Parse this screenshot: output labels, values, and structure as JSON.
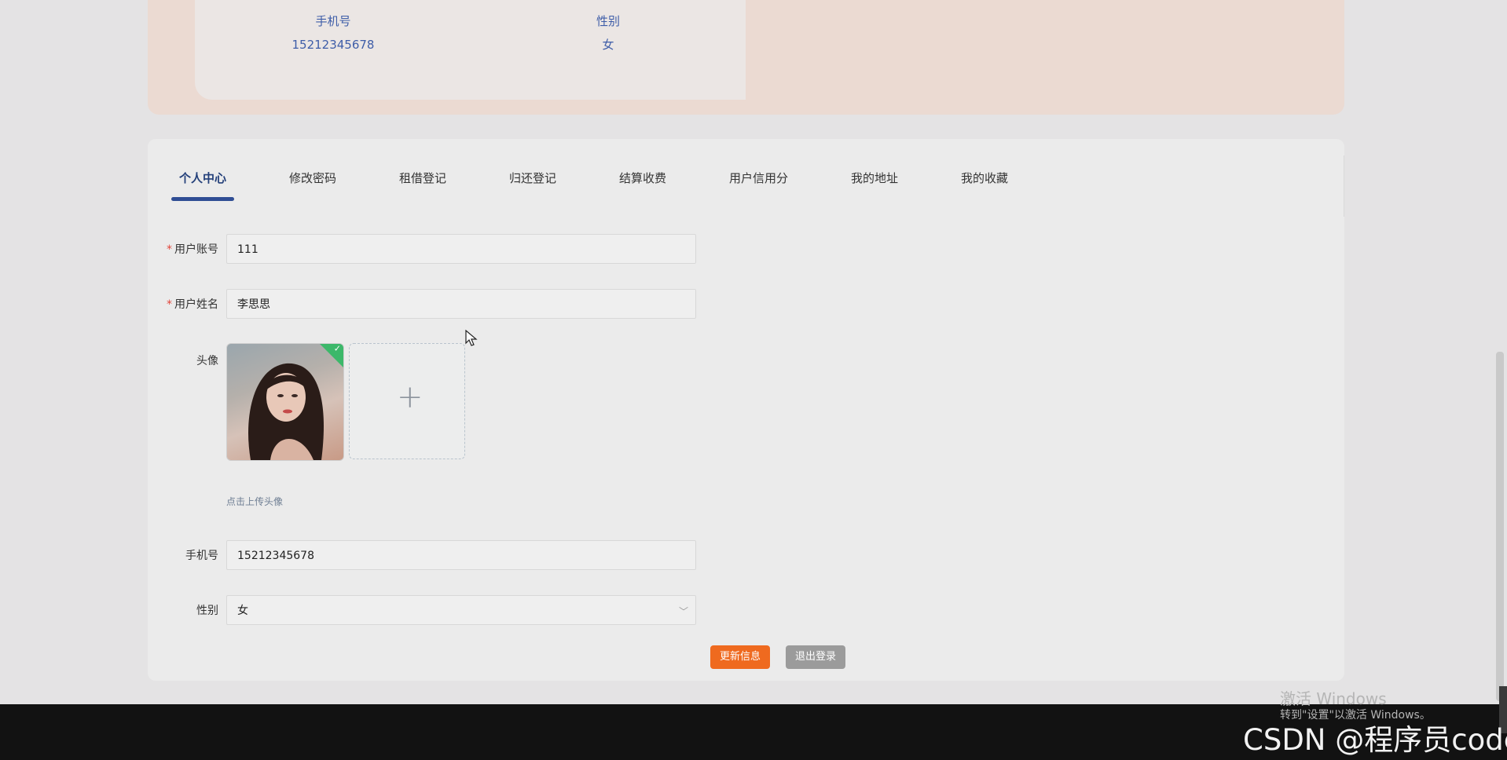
{
  "profile_summary": {
    "phone_label": "手机号",
    "phone_value": "15212345678",
    "gender_label": "性别",
    "gender_value": "女"
  },
  "tabs": [
    {
      "label": "个人中心",
      "active": true
    },
    {
      "label": "修改密码"
    },
    {
      "label": "租借登记"
    },
    {
      "label": "归还登记"
    },
    {
      "label": "结算收费"
    },
    {
      "label": "用户信用分"
    },
    {
      "label": "我的地址"
    },
    {
      "label": "我的收藏"
    }
  ],
  "form": {
    "account_label": "用户账号",
    "account_value": "111",
    "name_label": "用户姓名",
    "name_value": "李思思",
    "avatar_label": "头像",
    "avatar_hint": "点击上传头像",
    "phone_label": "手机号",
    "phone_value": "15212345678",
    "gender_label": "性别",
    "gender_value": "女",
    "required_mark": "*"
  },
  "buttons": {
    "update": "更新信息",
    "logout": "退出登录"
  },
  "windows_activation": {
    "title": "激活 Windows",
    "subtitle": "转到\"设置\"以激活 Windows。"
  },
  "watermark": "CSDN @程序员code",
  "colors": {
    "accent": "#2f4d94",
    "update_button": "#ef6a1f",
    "logout_button": "#9b9b9b",
    "required": "#e2453a",
    "success": "#3cb86a"
  },
  "icons": {
    "upload": "plus-icon",
    "select": "chevron-down-icon",
    "uploaded": "check-icon"
  }
}
